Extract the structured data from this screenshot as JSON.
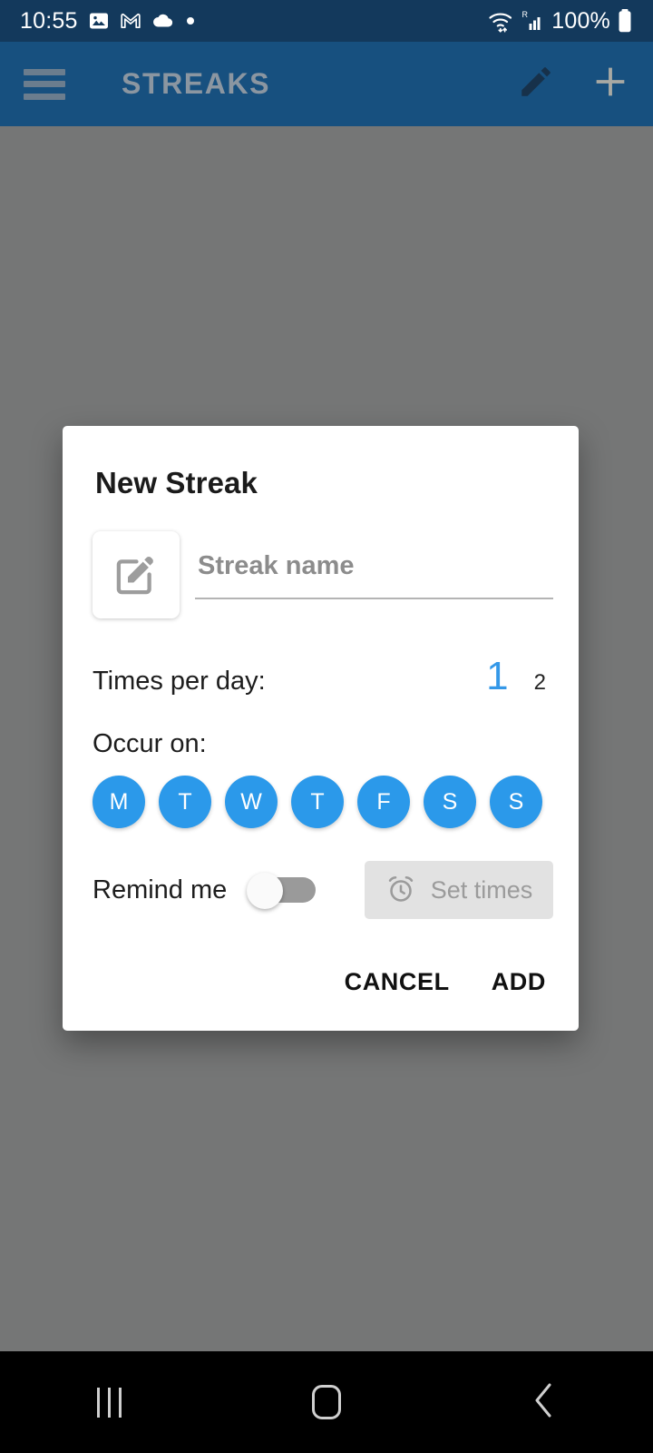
{
  "status_bar": {
    "time": "10:55",
    "battery_percent": "100%",
    "icons": [
      "photos-icon",
      "gmail-icon",
      "cloud-icon",
      "dot-icon"
    ],
    "right_icons": [
      "wifi-icon",
      "roaming-signal-icon",
      "battery-icon"
    ],
    "background_color": "#13395c"
  },
  "app_bar": {
    "menu_icon": "hamburger-menu-icon",
    "title": "STREAKS",
    "edit_icon": "pencil-edit-icon",
    "add_icon": "plus-add-icon",
    "background_color": "#17507f",
    "title_color": "#8b96a1"
  },
  "dialog": {
    "title": "New Streak",
    "name_field": {
      "icon": "compose-edit-icon",
      "value": "",
      "placeholder": "Streak name"
    },
    "times_per_day": {
      "label": "Times per day:",
      "selected": "1",
      "next": "2",
      "selected_color": "#3498e8"
    },
    "occur_on": {
      "label": "Occur on:",
      "days": [
        {
          "letter": "M",
          "name": "monday",
          "selected": true
        },
        {
          "letter": "T",
          "name": "tuesday",
          "selected": true
        },
        {
          "letter": "W",
          "name": "wednesday",
          "selected": true
        },
        {
          "letter": "T",
          "name": "thursday",
          "selected": true
        },
        {
          "letter": "F",
          "name": "friday",
          "selected": true
        },
        {
          "letter": "S",
          "name": "saturday",
          "selected": true
        },
        {
          "letter": "S",
          "name": "sunday",
          "selected": true
        }
      ],
      "selected_color": "#2b99ea"
    },
    "remind": {
      "label": "Remind me",
      "toggle_on": false,
      "set_times_label": "Set times",
      "set_times_icon": "alarm-clock-icon",
      "set_times_enabled": false
    },
    "actions": {
      "cancel": "CANCEL",
      "add": "ADD"
    }
  },
  "nav_bar": {
    "recents_icon": "recents-icon",
    "home_icon": "home-icon",
    "back_icon": "back-icon"
  }
}
